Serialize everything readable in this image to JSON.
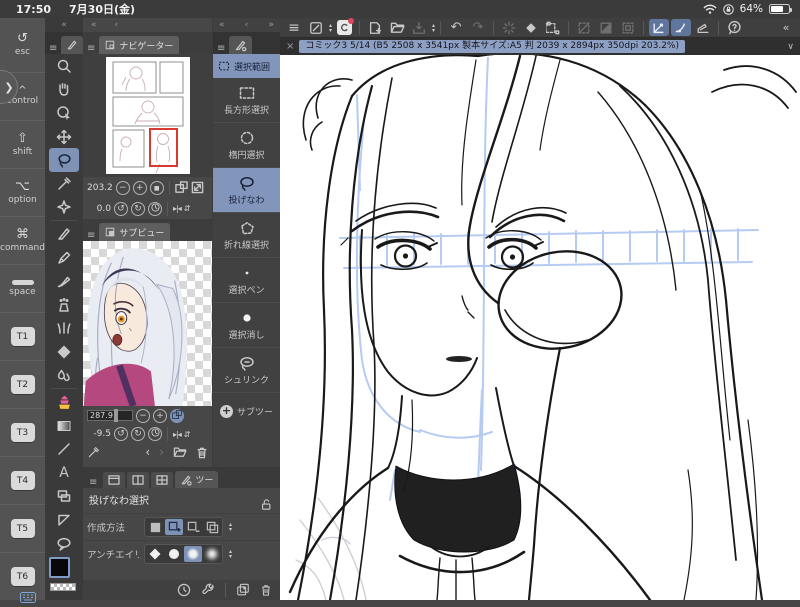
{
  "status_bar": {
    "time": "17:50",
    "date": "7月30日(金)",
    "battery_pct": "64%"
  },
  "title_bar": {
    "close": "×",
    "document_title": "コミック3 5/14 (B5 2508 x 3541px 製本サイズ:A5 判 2039 x 2894px 350dpi 203.2%)",
    "collapse_chevron": "∨"
  },
  "edge_keyboard": {
    "keys": [
      "esc",
      "control",
      "shift",
      "option",
      "command",
      "space",
      "T1",
      "T2",
      "T3",
      "T4",
      "T5",
      "T6"
    ],
    "key_icons": {
      "esc": "↺",
      "control": "^",
      "shift": "⇧",
      "option": "⌥",
      "command": "⌘"
    }
  },
  "panel_strip": {
    "collapse_tools": "«",
    "collapse_nav": "«",
    "prev_nav": "‹",
    "collapse_subtool": "«",
    "prev_subtool": "‹",
    "more_subtool": "»"
  },
  "toolbar": {
    "accent_color": "#60759c"
  },
  "icons": {
    "menu": "≡",
    "undo": "↶",
    "redo": "↷",
    "help": "?",
    "collapse": "«",
    "minus": "−",
    "plus": "+",
    "fit_dot": "■",
    "rotate_ccw": "↺",
    "rotate_cw": "↻",
    "flip_h": "▸|◂",
    "flip_v": "⇵",
    "prev": "‹",
    "next": "›",
    "step_up": "▴",
    "step_down": "▾",
    "text_tool": "A"
  },
  "navigator": {
    "tab_label": "ナビゲーター",
    "zoom_value": "203.2",
    "rotation_value": "0.0"
  },
  "subview": {
    "tab_label": "サブビュー",
    "zoom_value": "287.9",
    "rotation_value": "-9.5"
  },
  "subtool_panel": {
    "tab_label": "選択範囲",
    "selected_item": "投げなわ",
    "items": [
      {
        "label": "長方形選択"
      },
      {
        "label": "楕円選択"
      },
      {
        "label": "投げなわ"
      },
      {
        "label": "折れ線選択"
      },
      {
        "label": "選択ペン"
      },
      {
        "label": "選択消し"
      },
      {
        "label": "シュリンク"
      }
    ],
    "add_label": "サブツー"
  },
  "tool_property": {
    "tab_label": "ツー",
    "title": "投げなわ選択",
    "creation_label": "作成方法",
    "antialias_label": "アンチエイリ",
    "highlight_color": "#7e92b6"
  }
}
